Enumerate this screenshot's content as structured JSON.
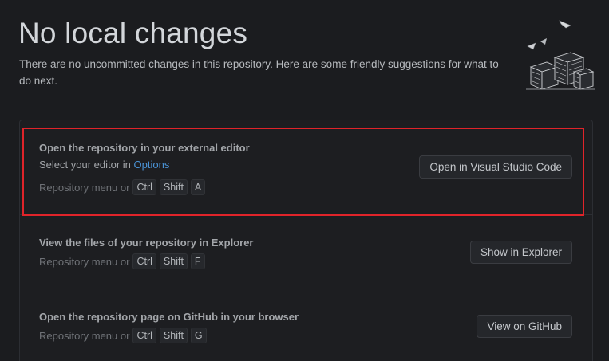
{
  "header": {
    "title": "No local changes",
    "subtitle": "There are no uncommitted changes in this repository. Here are some friendly suggestions for what to do next."
  },
  "suggestions": [
    {
      "title": "Open the repository in your external editor",
      "desc_prefix": "Select your editor in ",
      "desc_link": "Options",
      "menu_hint": "Repository menu or",
      "keys": [
        "Ctrl",
        "Shift",
        "A"
      ],
      "button": "Open in Visual Studio Code"
    },
    {
      "title": "View the files of your repository in Explorer",
      "menu_hint": "Repository menu or",
      "keys": [
        "Ctrl",
        "Shift",
        "F"
      ],
      "button": "Show in Explorer"
    },
    {
      "title": "Open the repository page on GitHub in your browser",
      "menu_hint": "Repository menu or",
      "keys": [
        "Ctrl",
        "Shift",
        "G"
      ],
      "button": "View on GitHub"
    }
  ],
  "colors": {
    "background": "#1b1c1f",
    "link": "#4a93d6",
    "highlight": "#e0242a"
  },
  "icons": {
    "illustration": "empty-desk-papers-illustration"
  }
}
